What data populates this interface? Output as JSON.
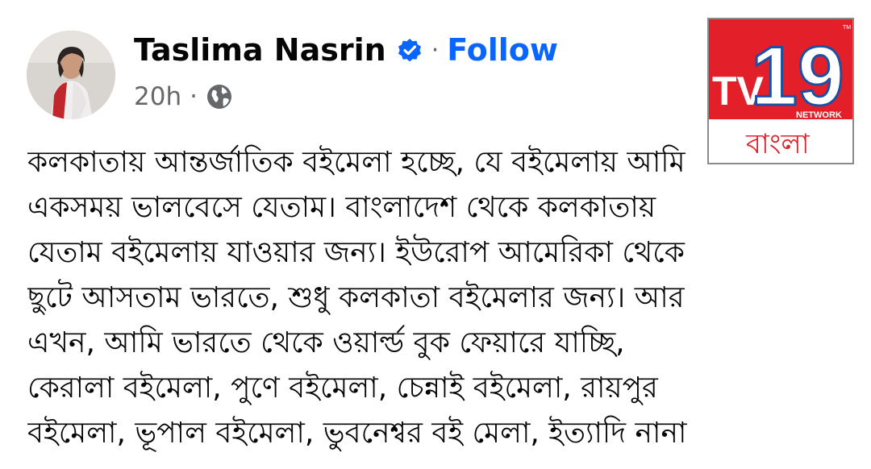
{
  "post": {
    "author": "Taslima Nasrin",
    "separator": "·",
    "follow_label": "Follow",
    "time": "20h",
    "meta_separator": "·",
    "privacy_icon": "globe-icon",
    "verified_icon": "verified-badge-icon",
    "text_lines": [
      "কলকাতায় আন্তর্জাতিক বইমেলা হচ্ছে, যে বইমেলায় আমি",
      "একসময় ভালবেসে যেতাম। বাংলাদেশ থেকে কলকাতায়",
      "যেতাম বইমেলায় যাওয়ার জন্য। ইউরোপ আমেরিকা থেকে",
      "ছুটে আসতাম ভারতে, শুধু কলকাতা বইমেলার জন্য।   আর",
      "এখন, আমি ভারতে থেকে ওয়ার্ল্ড বুক ফেয়ারে যাচ্ছি,",
      "কেরালা বইমেলা, পুণে বইমেলা, চেন্নাই বইমেলা, রায়পুর",
      "বইমেলা, ভূপাল বইমেলা, ভুবনেশ্বর বই মেলা, ইত্যাদি নানা"
    ]
  },
  "watermark": {
    "brand": "TV",
    "number": "19",
    "trademark": "TM",
    "network": "NETWORK",
    "language": "বাংলা"
  },
  "colors": {
    "follow": "#0866ff",
    "verified": "#0866ff",
    "muted": "#65676b",
    "logo_red": "#e3202a",
    "logo_blue": "#1d4fa3"
  }
}
